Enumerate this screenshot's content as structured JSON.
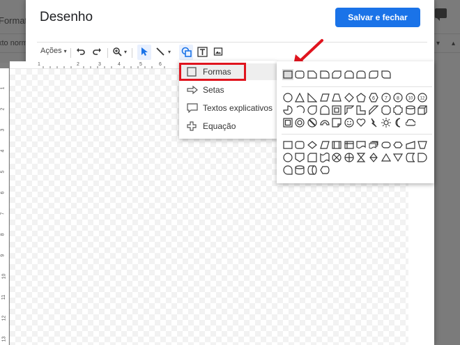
{
  "background": {
    "menu_fragment": "Formata",
    "style_fragment": "xto norm."
  },
  "dialog": {
    "title": "Desenho",
    "save_button": "Salvar e fechar"
  },
  "toolbar": {
    "actions_label": "Ações",
    "actions_caret": "▾",
    "undo_icon": "undo-icon",
    "redo_icon": "redo-icon",
    "zoom_icon": "zoom-icon",
    "select_icon": "select-icon",
    "line_icon": "line-icon",
    "shape_icon": "shape-icon",
    "textbox_icon": "text-box-icon",
    "image_icon": "image-icon"
  },
  "ruler": {
    "h_numbers": [
      "1",
      "2",
      "3",
      "4",
      "5",
      "6"
    ],
    "v_numbers": [
      "1",
      "2",
      "3",
      "4",
      "5",
      "6",
      "7",
      "8",
      "9",
      "10",
      "11",
      "12",
      "13"
    ]
  },
  "shape_menu": {
    "items": [
      {
        "label": "Formas",
        "icon": "square-icon"
      },
      {
        "label": "Setas",
        "icon": "arrow-icon"
      },
      {
        "label": "Textos explicativos",
        "icon": "callout-icon"
      },
      {
        "label": "Equação",
        "icon": "plus-icon"
      }
    ]
  },
  "colors": {
    "accent": "#1a73e8",
    "highlight_red": "#e0141e",
    "selected_tool_bg": "#e8f0fe"
  }
}
